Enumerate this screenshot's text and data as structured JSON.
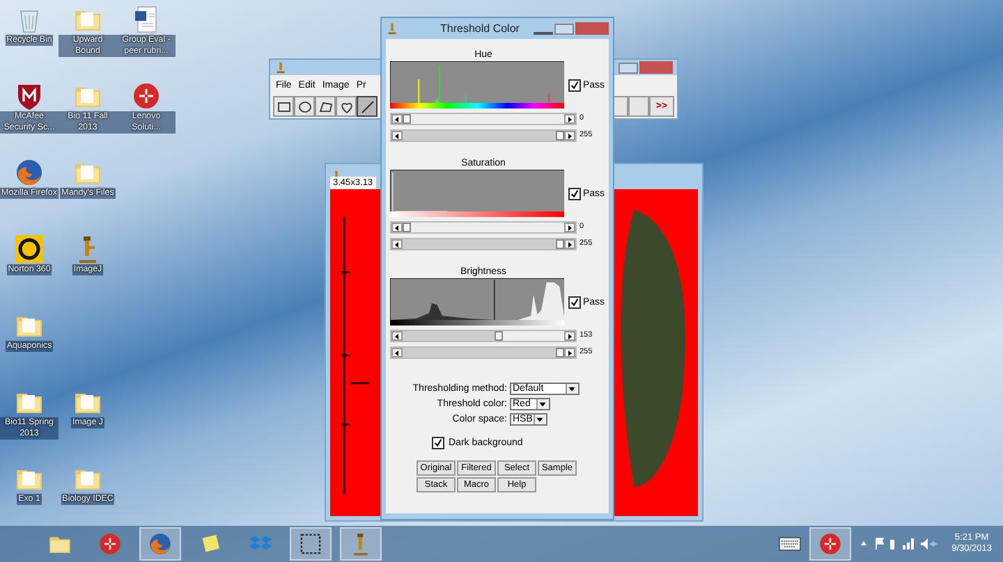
{
  "desktop_icons": [
    [
      {
        "kind": "bin",
        "label": "Recycle Bin"
      },
      {
        "kind": "folder",
        "label": "Upward Bound"
      },
      {
        "kind": "word",
        "label": "Group Eval - peer rubri..."
      }
    ],
    [
      {
        "kind": "shield",
        "label": "McAfee Security Sc..."
      },
      {
        "kind": "folder",
        "label": "Bio 11 Fall 2013"
      },
      {
        "kind": "lenovo",
        "label": "Lenovo Soluti..."
      }
    ],
    [
      {
        "kind": "firefox",
        "label": "Mozilla Firefox"
      },
      {
        "kind": "folder",
        "label": "Mandy's Files"
      }
    ],
    [
      {
        "kind": "norton",
        "label": "Norton 360"
      },
      {
        "kind": "microscope",
        "label": "ImageJ"
      }
    ],
    [
      {
        "kind": "folder",
        "label": "Aquaponics"
      }
    ],
    [
      {
        "kind": "folder",
        "label": "Bio11 Spring 2013"
      },
      {
        "kind": "folder",
        "label": "Image J"
      }
    ],
    [
      {
        "kind": "folder",
        "label": "Exo 1"
      },
      {
        "kind": "folder",
        "label": "Biology IDEC"
      }
    ]
  ],
  "imagej_window": {
    "menu": [
      "File",
      "Edit",
      "Image",
      "Pr"
    ],
    "tools": [
      {
        "kind": "rect",
        "selected": false
      },
      {
        "kind": "oval",
        "selected": false
      },
      {
        "kind": "polygon",
        "selected": false
      },
      {
        "kind": "freehand",
        "selected": false
      },
      {
        "kind": "line",
        "selected": true
      }
    ],
    "more_button": ">>"
  },
  "image_window": {
    "title": "3.45x3.13"
  },
  "threshold_dialog": {
    "title": "Threshold Color",
    "channels": [
      {
        "kind": "hue",
        "label": "Hue",
        "pass": true,
        "pass_label": "Pass",
        "min": {
          "level": 0,
          "reading": "0"
        },
        "max": {
          "level": 1,
          "reading": "255"
        }
      },
      {
        "kind": "saturation",
        "label": "Saturation",
        "pass": true,
        "pass_label": "Pass",
        "min": {
          "level": 0,
          "reading": "0"
        },
        "max": {
          "level": 1,
          "reading": "255"
        }
      },
      {
        "kind": "brightness",
        "label": "Brightness",
        "pass": true,
        "pass_label": "Pass",
        "min": {
          "level": 0.6,
          "reading": "153"
        },
        "max": {
          "level": 1,
          "reading": "255"
        }
      }
    ],
    "options": [
      {
        "label": "Thresholding method:",
        "value": "Default"
      },
      {
        "label": "Threshold color:",
        "value": "Red"
      },
      {
        "label": "Color space:",
        "value": "HSB"
      }
    ],
    "dark_background": {
      "label": "Dark background",
      "checked": true
    },
    "buttons": [
      "Original",
      "Filtered",
      "Select",
      "Sample",
      "Stack",
      "Macro",
      "Help"
    ]
  },
  "taskbar": {
    "apps": [
      {
        "kind": "folder",
        "active": false
      },
      {
        "kind": "lenovo",
        "active": false
      },
      {
        "kind": "firefox",
        "active": true
      },
      {
        "kind": "note",
        "active": false
      },
      {
        "kind": "dropbox",
        "active": false
      },
      {
        "kind": "capture",
        "active": true
      },
      {
        "kind": "microscope",
        "active": true
      }
    ],
    "time": "5:21 PM",
    "date": "9/30/2013"
  }
}
